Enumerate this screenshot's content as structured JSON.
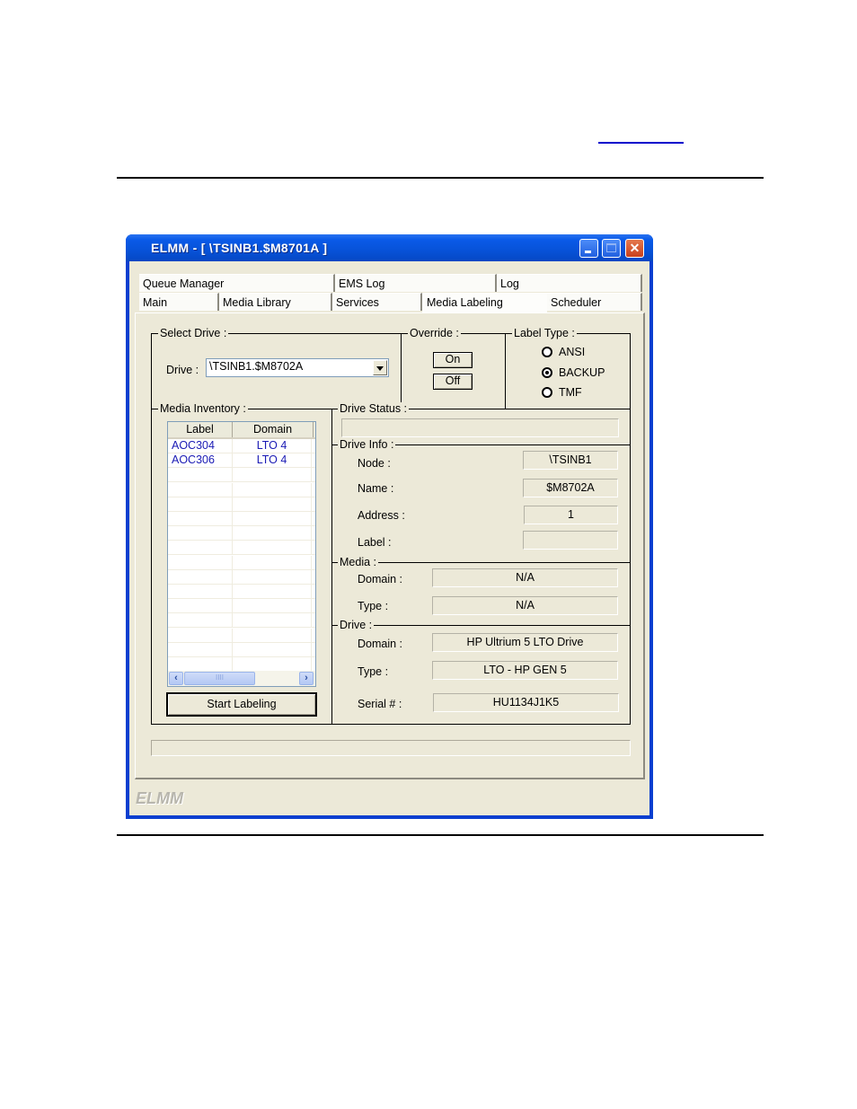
{
  "document": {
    "link_text": ""
  },
  "window": {
    "title": "ELMM - [ \\TSINB1.$M8701A ]",
    "controls": {
      "minimize": "_",
      "maximize": "□",
      "close": "✕"
    },
    "brand": "ELMM"
  },
  "tabs": {
    "row1": [
      {
        "label": "Queue Manager"
      },
      {
        "label": "EMS Log"
      },
      {
        "label": "Log"
      }
    ],
    "row2": [
      {
        "label": "Main"
      },
      {
        "label": "Media Library"
      },
      {
        "label": "Services"
      },
      {
        "label": "Media Labeling",
        "active": true
      },
      {
        "label": "Scheduler"
      }
    ]
  },
  "select_drive": {
    "legend": "Select Drive :",
    "drive_label": "Drive :",
    "drive_value": "\\TSINB1.$M8702A"
  },
  "override": {
    "legend": "Override :",
    "on_label": "On",
    "off_label": "Off"
  },
  "label_type": {
    "legend": "Label Type :",
    "options": [
      {
        "label": "ANSI",
        "checked": false
      },
      {
        "label": "BACKUP",
        "checked": true
      },
      {
        "label": "TMF",
        "checked": false
      }
    ]
  },
  "media_inventory": {
    "legend": "Media Inventory :",
    "columns": [
      "Label",
      "Domain"
    ],
    "rows": [
      {
        "label": "AOC304",
        "domain": "LTO 4"
      },
      {
        "label": "AOC306",
        "domain": "LTO 4"
      }
    ],
    "scroll_thumb": "IIII",
    "start_button": "Start Labeling"
  },
  "drive_status": {
    "legend": "Drive Status :",
    "value": ""
  },
  "drive_info": {
    "legend": "Drive Info :",
    "fields": [
      {
        "label": "Node :",
        "value": "\\TSINB1"
      },
      {
        "label": "Name :",
        "value": "$M8702A"
      },
      {
        "label": "Address :",
        "value": "1"
      },
      {
        "label": "Label :",
        "value": ""
      }
    ]
  },
  "media": {
    "legend": "Media :",
    "fields": [
      {
        "label": "Domain :",
        "value": "N/A"
      },
      {
        "label": "Type :",
        "value": "N/A"
      }
    ]
  },
  "drive": {
    "legend": "Drive :",
    "fields": [
      {
        "label": "Domain :",
        "value": "HP Ultrium 5 LTO Drive"
      },
      {
        "label": "Type :",
        "value": "LTO - HP GEN 5"
      },
      {
        "label": "Serial # :",
        "value": "HU1134J1K5"
      }
    ]
  },
  "status_bar": {
    "value": ""
  }
}
